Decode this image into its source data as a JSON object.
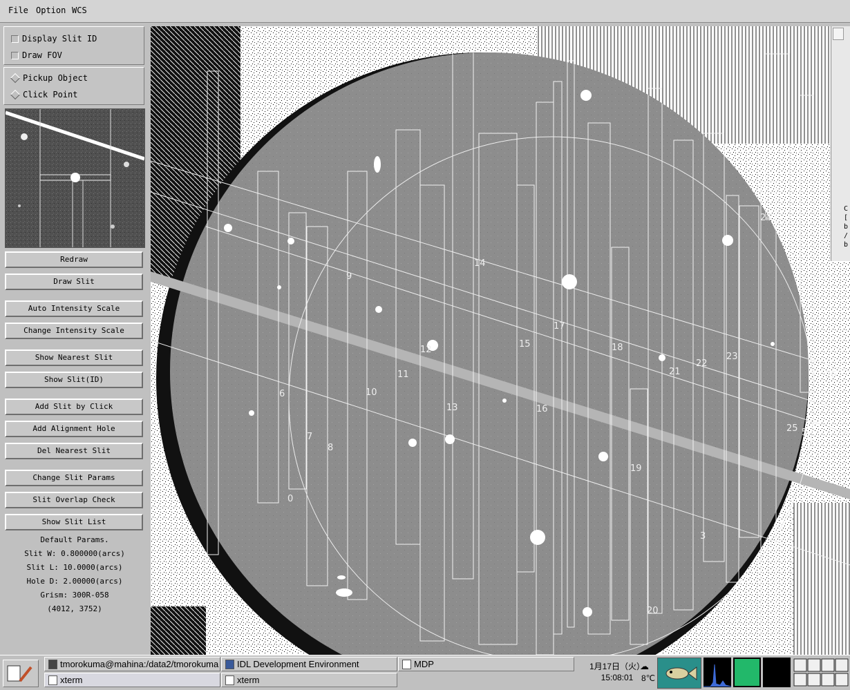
{
  "menubar": {
    "items": [
      "File",
      "Option",
      "WCS"
    ]
  },
  "options": {
    "display_slit_id": "Display Slit ID",
    "draw_fov": "Draw FOV",
    "pickup_object": "Pickup Object",
    "click_point": "Click Point"
  },
  "buttons": {
    "redraw": "Redraw",
    "draw_slit": "Draw Slit",
    "auto_intensity": "Auto Intensity Scale",
    "change_intensity": "Change Intensity Scale",
    "show_nearest": "Show Nearest Slit",
    "show_slit_id": "Show Slit(ID)",
    "add_slit_click": "Add Slit by Click",
    "add_alignment": "Add Alignment Hole",
    "del_nearest": "Del Nearest Slit",
    "change_params": "Change Slit Params",
    "overlap_check": "Slit Overlap Check",
    "show_list": "Show Slit List"
  },
  "params": {
    "title": "Default Params.",
    "slit_w": "Slit W: 0.800000(arcs)",
    "slit_l": "Slit L: 10.0000(arcs)",
    "hole_d": "Hole D: 2.00000(arcs)",
    "grism": "Grism: 300R-058",
    "coords": "(4012, 3752)"
  },
  "slit_labels": [
    "6",
    "7",
    "8",
    "9",
    "10",
    "11",
    "12",
    "13",
    "14",
    "15",
    "16",
    "17",
    "18",
    "19",
    "20",
    "21",
    "22",
    "23",
    "24",
    "25",
    "26",
    "3",
    "0",
    "5"
  ],
  "scroll_text": [
    "C",
    "[",
    "b",
    "/",
    "b"
  ],
  "taskbar": {
    "win1": "tmorokuma@mahina:/data2/tmorokuma",
    "win2": "IDL Development Environment",
    "win3": "MDP",
    "win4": "xterm",
    "win5": "xterm",
    "date": "1月17日（火）",
    "time": "15:08:01",
    "temp": "8℃"
  },
  "colors": {
    "panel": "#c0c0c0",
    "image_bg": "#ffffff",
    "sky": "#8e8e8e",
    "slit": "#ffffff",
    "cpu_green": "#22b86a"
  }
}
